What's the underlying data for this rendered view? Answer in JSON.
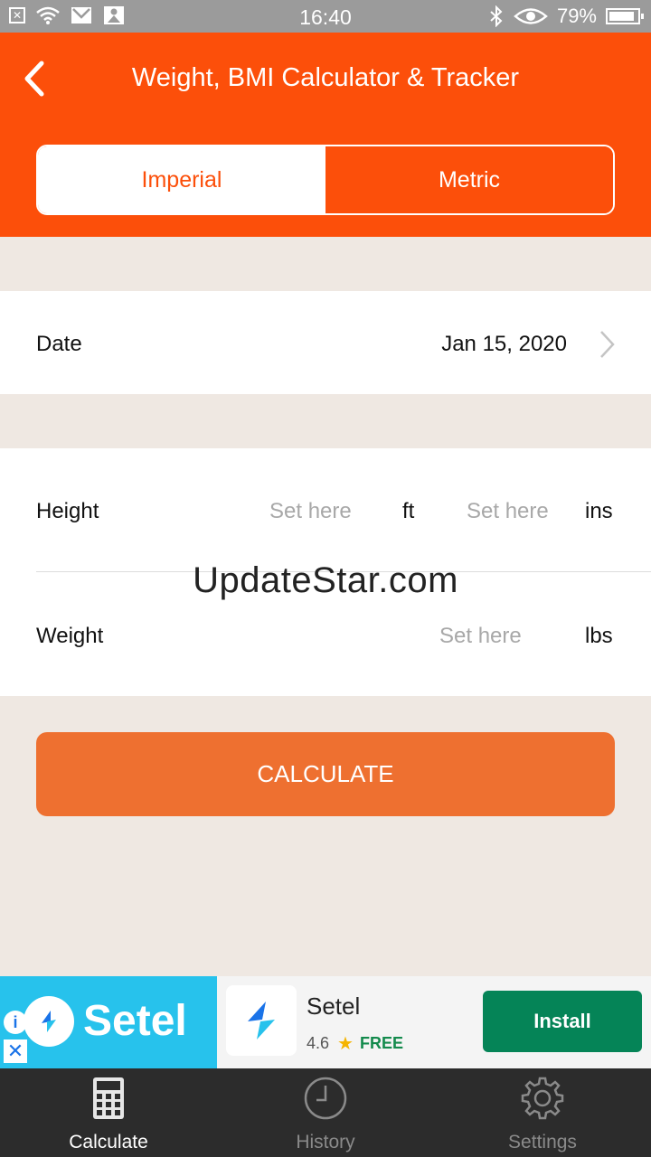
{
  "status_bar": {
    "time": "16:40",
    "battery": "79%",
    "icons": [
      "close-box-icon",
      "wifi-icon",
      "mail-icon",
      "app-icon",
      "bluetooth-icon",
      "eye-icon",
      "battery-icon"
    ]
  },
  "header": {
    "title": "Weight, BMI Calculator & Tracker",
    "back_icon": "chevron-left-icon"
  },
  "unit_toggle": {
    "options": [
      {
        "label": "Imperial",
        "selected": true
      },
      {
        "label": "Metric",
        "selected": false
      }
    ]
  },
  "date_row": {
    "label": "Date",
    "value": "Jan 15, 2020"
  },
  "height_row": {
    "label": "Height",
    "feet_placeholder": "Set here",
    "feet_unit": "ft",
    "inches_placeholder": "Set here",
    "inches_unit": "ins"
  },
  "weight_row": {
    "label": "Weight",
    "placeholder": "Set here",
    "unit": "lbs"
  },
  "watermark": "UpdateStar.com",
  "calculate_button": {
    "label": "CALCULATE"
  },
  "ad": {
    "banner_text": "Setel",
    "app_name": "Setel",
    "rating": "4.6",
    "price": "FREE",
    "install_label": "Install"
  },
  "bottom_nav": {
    "items": [
      {
        "label": "Calculate",
        "icon": "calculator-icon",
        "active": true
      },
      {
        "label": "History",
        "icon": "clock-icon",
        "active": false
      },
      {
        "label": "Settings",
        "icon": "gear-icon",
        "active": false
      }
    ]
  },
  "colors": {
    "accent": "#fc4f0a",
    "button": "#ee7030",
    "background": "#efe8e2",
    "install": "#058457",
    "nav_bg": "#2c2c2c"
  }
}
